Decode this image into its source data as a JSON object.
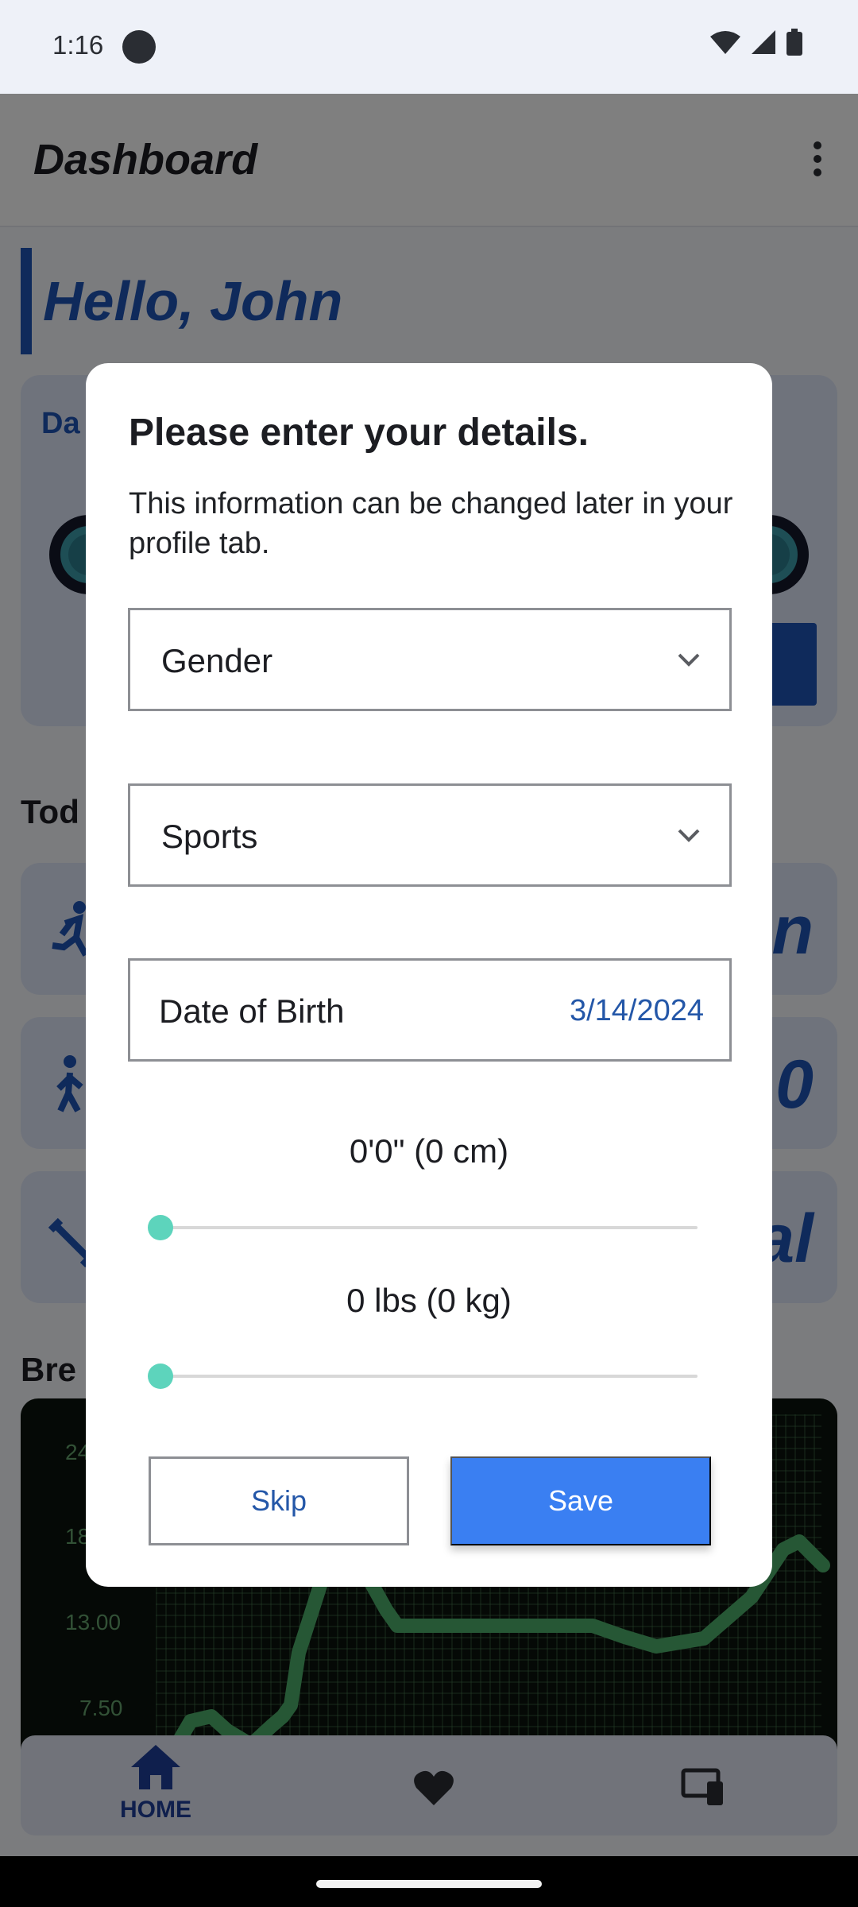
{
  "status_bar": {
    "time": "1:16"
  },
  "app": {
    "title": "Dashboard",
    "greeting": "Hello, John",
    "daily_card_title": "Da",
    "today_section_title": "Tod",
    "stat_values": [
      "n",
      "0",
      "al"
    ],
    "breath_section_title": "Bre",
    "chart_ticks": [
      "24",
      "18",
      "13.00",
      "7.50"
    ]
  },
  "bottom_nav": {
    "home_label": "HOME"
  },
  "dialog": {
    "title": "Please enter your details.",
    "description": "This information can be changed later in your profile tab.",
    "gender_label": "Gender",
    "sports_label": "Sports",
    "dob_label": "Date of Birth",
    "dob_value": "3/14/2024",
    "height_text": "0'0\" (0 cm)",
    "height_fraction": 0,
    "weight_text": "0 lbs (0 kg)",
    "weight_fraction": 0,
    "skip_label": "Skip",
    "save_label": "Save"
  },
  "colors": {
    "accent": "#3a7ff2",
    "brand_blue": "#1f55b6",
    "slider": "#5dd4bc"
  }
}
